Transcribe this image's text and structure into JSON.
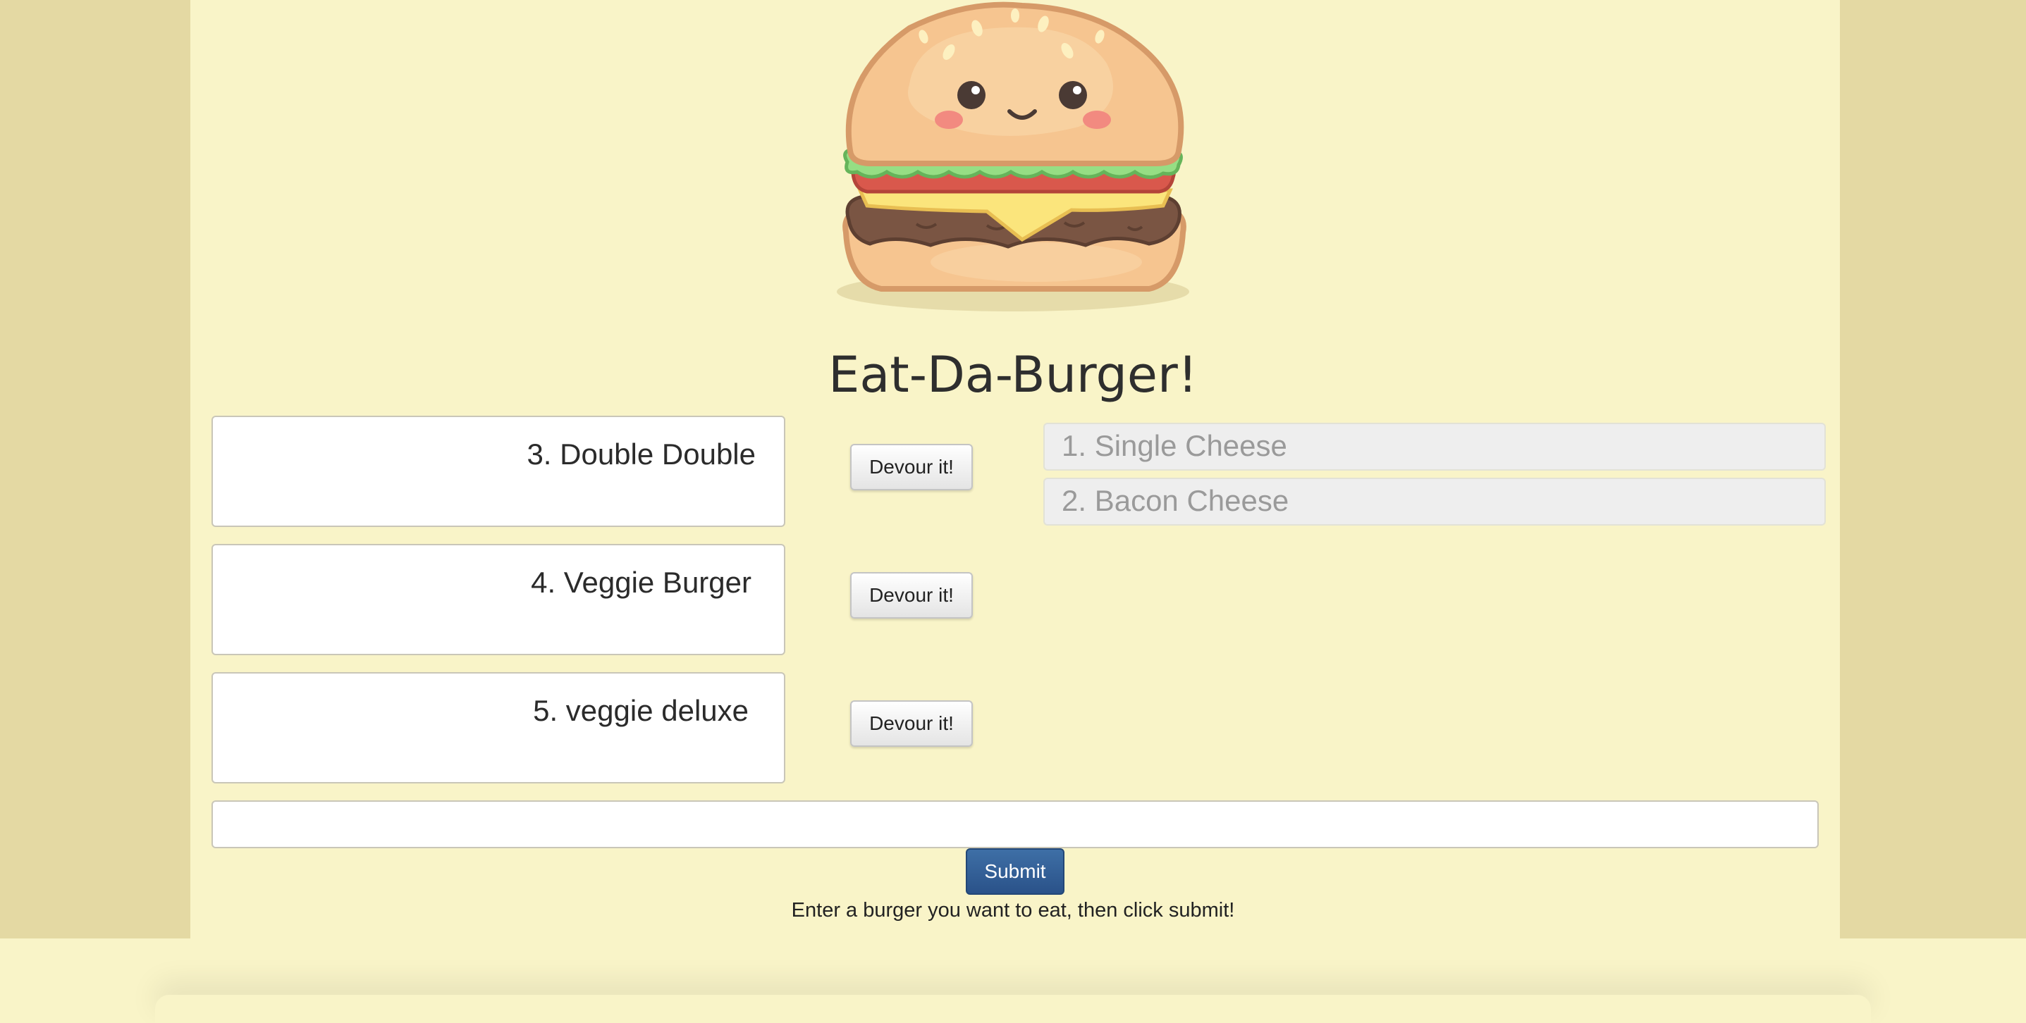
{
  "header": {
    "title": "Eat-Da-Burger!",
    "logo_icon": "kawaii-burger-icon"
  },
  "uneaten_burgers": [
    {
      "label": "3. Double Double",
      "button_label": "Devour it!"
    },
    {
      "label": "4. Veggie Burger",
      "button_label": "Devour it!"
    },
    {
      "label": "5. veggie deluxe",
      "button_label": "Devour it!"
    }
  ],
  "devoured_burgers": [
    {
      "label": "1. Single Cheese"
    },
    {
      "label": "2. Bacon Cheese"
    }
  ],
  "form": {
    "input_value": "",
    "submit_label": "Submit",
    "hint": "Enter a burger you want to eat, then click submit!"
  },
  "colors": {
    "background": "#f9f4c8",
    "side_panels": "#e4d9a3",
    "submit_button": "#2f5a91",
    "devoured_text": "#9a9a9a"
  }
}
